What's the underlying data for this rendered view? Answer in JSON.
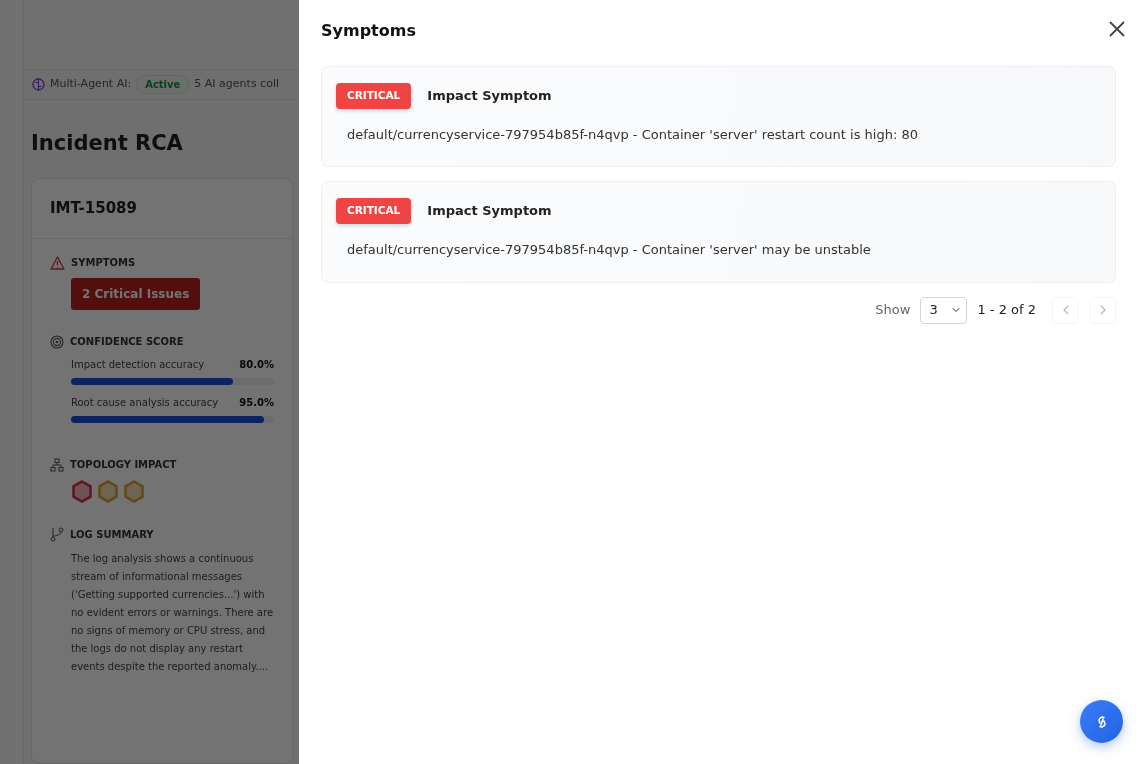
{
  "background": {
    "status": {
      "label": "Multi-Agent AI:",
      "badge": "Active",
      "text": "5 AI agents coll"
    },
    "page_title": "Incident RCA",
    "incident": {
      "id": "IMT-15089",
      "symptoms": {
        "heading": "SYMPTOMS",
        "button": "2 Critical Issues"
      },
      "confidence": {
        "heading": "CONFIDENCE SCORE",
        "metrics": [
          {
            "label": "Impact detection accuracy",
            "value": "80.0%",
            "level": 0.8
          },
          {
            "label": "Root cause analysis accuracy",
            "value": "95.0%",
            "level": 0.95
          }
        ]
      },
      "topology": {
        "heading": "TOPOLOGY IMPACT",
        "nodes": [
          {
            "color": "#621421"
          },
          {
            "color": "#654813"
          },
          {
            "color": "#654813"
          }
        ]
      },
      "log_summary": {
        "heading": "LOG SUMMARY",
        "text": "The log analysis shows a continuous stream of informational messages ('Getting supported currencies...') with no evident errors or warnings. There are no signs of memory or CPU stress, and the logs do not display any restart events despite the reported anomaly...."
      }
    }
  },
  "drawer": {
    "title": "Symptoms",
    "symptoms": [
      {
        "severity": "CRITICAL",
        "title": "Impact Symptom",
        "description": "default/currencyservice-797954b85f-n4qvp - Container 'server' restart count is high: 80"
      },
      {
        "severity": "CRITICAL",
        "title": "Impact Symptom",
        "description": "default/currencyservice-797954b85f-n4qvp - Container 'server' may be unstable"
      }
    ],
    "pagination": {
      "show_label": "Show",
      "page_size": "3",
      "range": "1 - 2 of 2",
      "prev": {
        "disabled": true
      },
      "next": {
        "disabled": true
      }
    }
  }
}
